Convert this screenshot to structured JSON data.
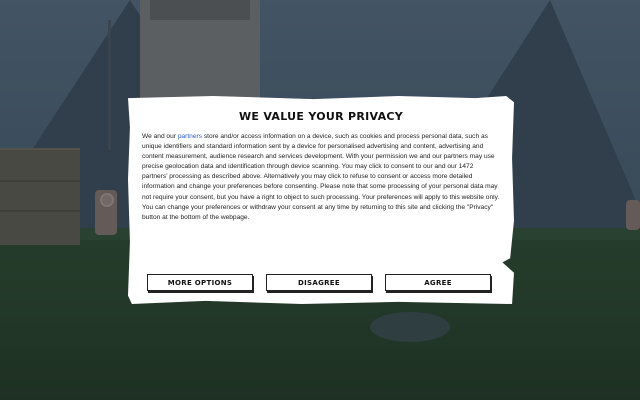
{
  "consent_dialog": {
    "title": "WE VALUE YOUR PRIVACY",
    "body_before_link": "We and our ",
    "partners_link": "partners",
    "body_after_link": " store and/or access information on a device, such as cookies and process personal data, such as unique identifiers and standard information sent by a device for personalised advertising and content, advertising and content measurement, audience research and services development. With your permission we and our partners may use precise geolocation data and identification through device scanning. You may click to consent to our and our 1472 partners' processing as described above. Alternatively you may click to refuse to consent or access more detailed information and change your preferences before consenting. Please note that some processing of your personal data may not require your consent, but you have a right to object to such processing. Your preferences will apply to this website only. You can change your preferences or withdraw your consent at any time by returning to this site and clicking the \"Privacy\" button at the bottom of the webpage.",
    "buttons": {
      "more_options": "MORE OPTIONS",
      "disagree": "DISAGREE",
      "agree": "AGREE"
    }
  },
  "colors": {
    "link": "#2a62c9",
    "dialog_background": "#ffffff",
    "button_border": "#222222"
  }
}
